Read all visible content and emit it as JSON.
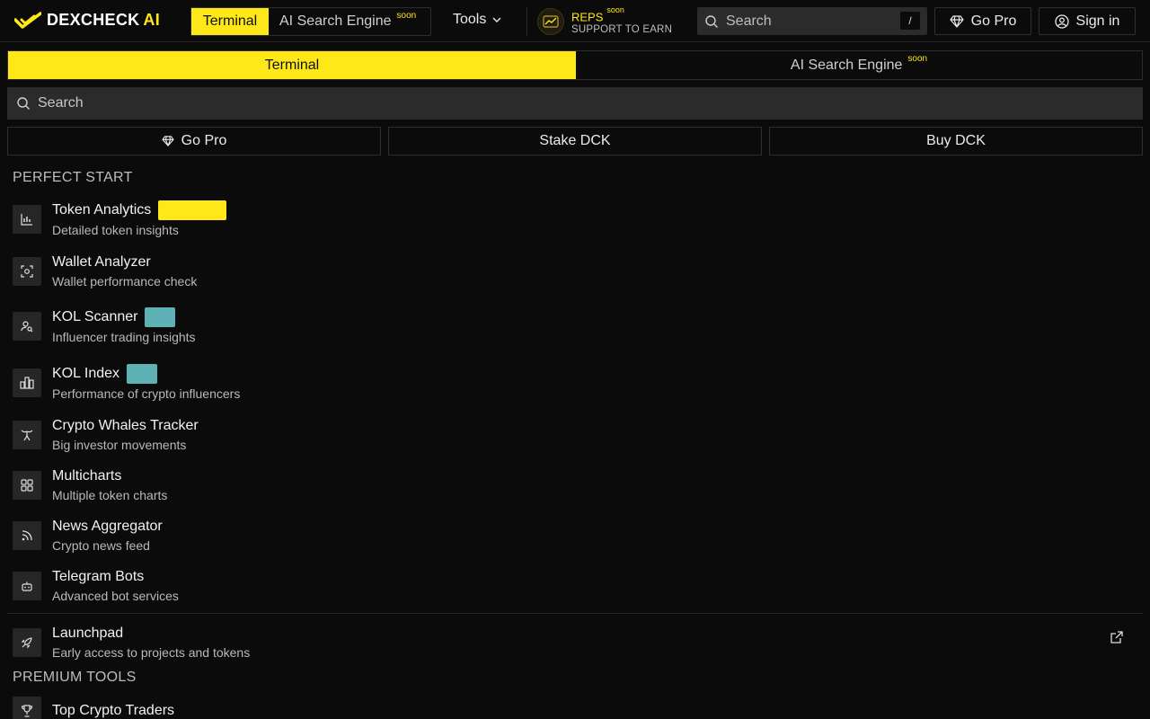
{
  "brand": {
    "name": "DEXCHECK",
    "ai": "AI",
    "accent": "#ffe818"
  },
  "header": {
    "tab_terminal": "Terminal",
    "tab_ai_search": "AI Search Engine",
    "soon": "soon",
    "tools": "Tools",
    "reps_title": "REPS",
    "reps_soon": "soon",
    "reps_sub": "SUPPORT TO EARN",
    "search_placeholder": "Search",
    "search_shortcut": "/",
    "go_pro": "Go Pro",
    "sign_in": "Sign in"
  },
  "main": {
    "tab_terminal": "Terminal",
    "tab_ai_search": "AI Search Engine",
    "soon": "soon",
    "search_placeholder": "Search",
    "actions": {
      "go_pro": "Go Pro",
      "stake": "Stake DCK",
      "buy": "Buy DCK"
    }
  },
  "sections": {
    "perfect_start": "PERFECT START",
    "premium_tools": "PREMIUM TOOLS"
  },
  "items": [
    {
      "title": "Token Analytics",
      "desc": "Detailed token insights",
      "icon": "chart-icon",
      "badge": "yellow"
    },
    {
      "title": "Wallet Analyzer",
      "desc": "Wallet performance check",
      "icon": "scan-icon"
    },
    {
      "title": "KOL Scanner",
      "desc": "Influencer trading insights",
      "icon": "user-search-icon",
      "badge": "teal"
    },
    {
      "title": "KOL Index",
      "desc": "Performance of crypto influencers",
      "icon": "bar-chart-icon",
      "badge": "teal"
    },
    {
      "title": "Crypto Whales Tracker",
      "desc": "Big investor movements",
      "icon": "whale-tail-icon"
    },
    {
      "title": "Multicharts",
      "desc": "Multiple token charts",
      "icon": "grid-icon"
    },
    {
      "title": "News Aggregator",
      "desc": "Crypto news feed",
      "icon": "rss-icon"
    },
    {
      "title": "Telegram Bots",
      "desc": "Advanced bot services",
      "icon": "bot-icon"
    },
    {
      "title": "Launchpad",
      "desc": "Early access to projects and tokens",
      "icon": "rocket-icon"
    },
    {
      "title": "Top Crypto Traders",
      "desc": "",
      "icon": "trophy-icon"
    }
  ]
}
